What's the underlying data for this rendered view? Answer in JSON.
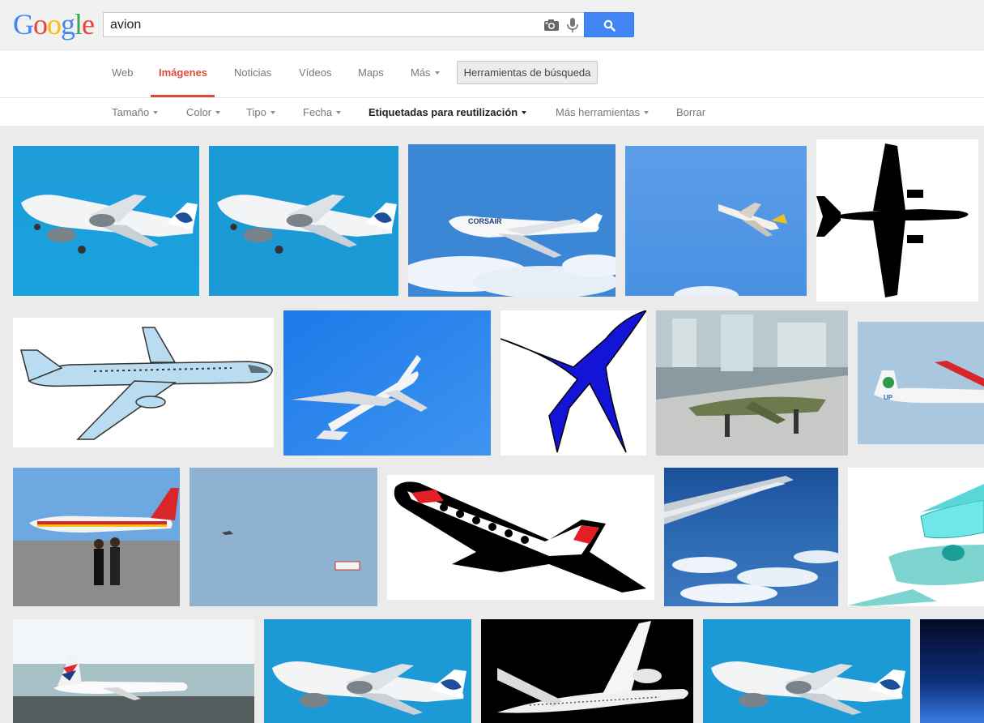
{
  "logo": "Google",
  "search": {
    "query": "avion",
    "camera_icon": "camera-icon",
    "mic_icon": "microphone-icon",
    "search_icon": "magnifier-icon"
  },
  "nav": {
    "tabs": [
      "Web",
      "Imágenes",
      "Noticias",
      "Vídeos",
      "Maps",
      "Más"
    ],
    "active_tab": "Imágenes",
    "tools_button": "Herramientas de búsqueda"
  },
  "tools": {
    "items": [
      "Tamaño",
      "Color",
      "Tipo",
      "Fecha",
      "Etiquetadas para reutilización",
      "Más herramientas",
      "Borrar"
    ],
    "selected": "Etiquetadas para reutilización"
  },
  "colors": {
    "brand_blue": "#4285f4",
    "active_red": "#dd4b39",
    "sky_blue": "#1e9bd7"
  },
  "results": [
    {
      "description": "airliner-sky-1"
    },
    {
      "description": "airliner-sky-2"
    },
    {
      "description": "corsair-747"
    },
    {
      "description": "airliner-climbing"
    },
    {
      "description": "black-silhouette"
    },
    {
      "description": "cartoon-light-blue"
    },
    {
      "description": "jumbo-blue-sky"
    },
    {
      "description": "blue-icon"
    },
    {
      "description": "model-aircraft"
    },
    {
      "description": "plane-partial-1"
    },
    {
      "description": "iberia-airport"
    },
    {
      "description": "distant-plane-banner"
    },
    {
      "description": "red-black-cartoon"
    },
    {
      "description": "wing-over-clouds"
    },
    {
      "description": "cyan-cartoon"
    },
    {
      "description": "air-france-airport"
    },
    {
      "description": "airliner-sky-3"
    },
    {
      "description": "white-3d-render"
    },
    {
      "description": "airliner-sky-4"
    },
    {
      "description": "space-partial"
    }
  ]
}
